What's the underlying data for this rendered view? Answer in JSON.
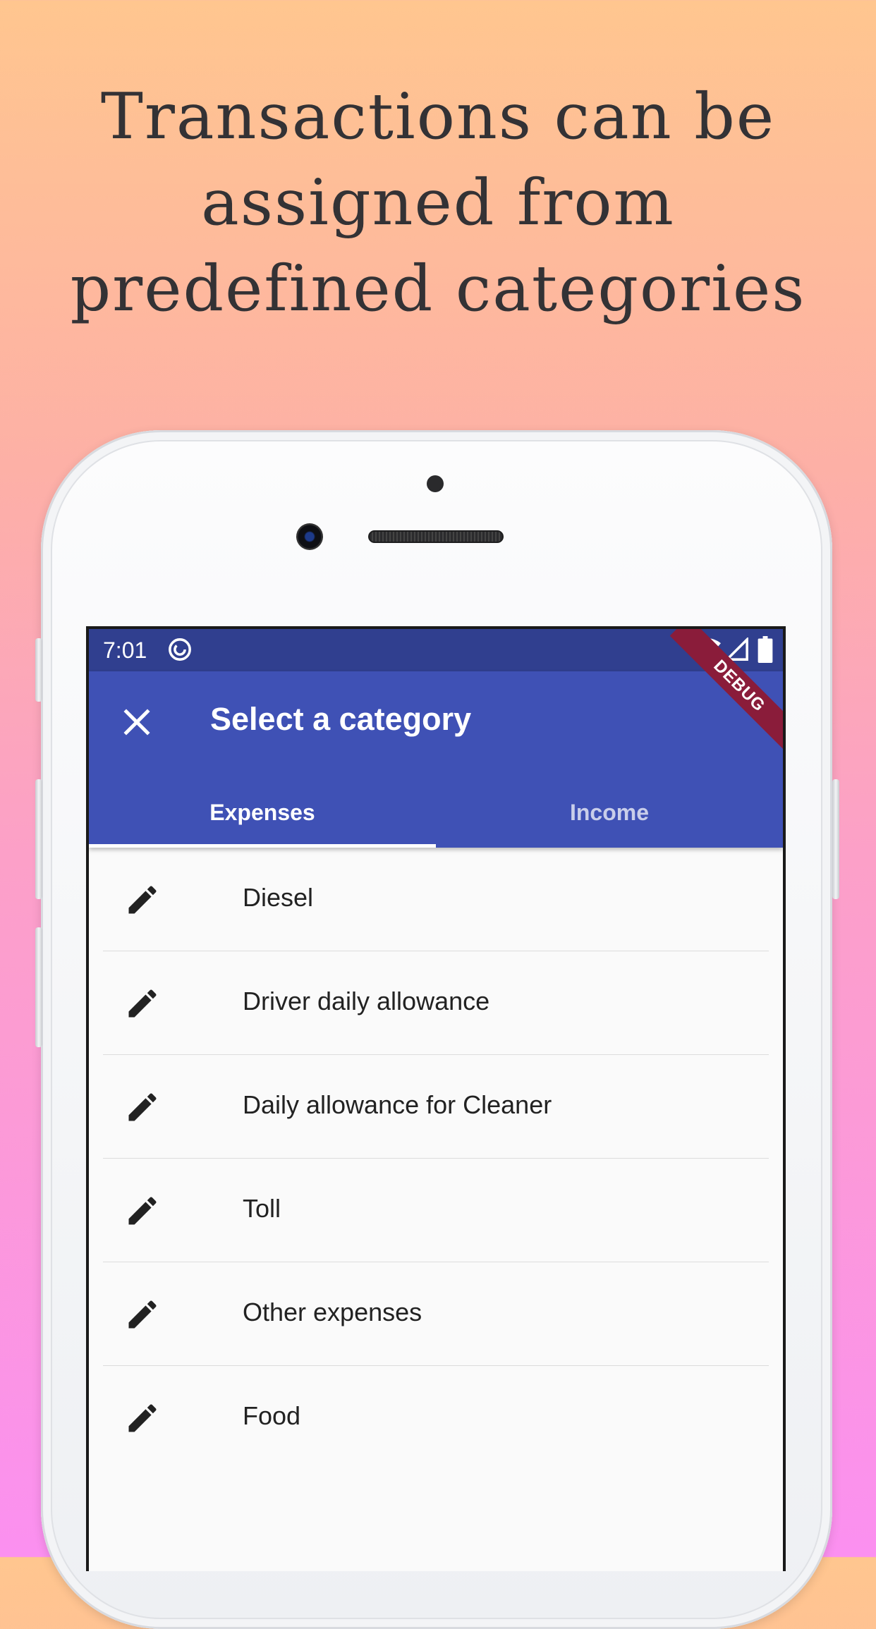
{
  "headline": {
    "line1": "Transactions can be",
    "line2": "assigned from",
    "line3": "predefined categories"
  },
  "statusbar": {
    "time": "7:01",
    "icons": [
      "sync-icon",
      "wifi-icon",
      "signal-icon",
      "battery-icon"
    ]
  },
  "appbar": {
    "close_icon": "close-icon",
    "title": "Select a category",
    "debug_label": "DEBUG"
  },
  "tabs": [
    {
      "label": "Expenses",
      "selected": true
    },
    {
      "label": "Income",
      "selected": false
    }
  ],
  "categories": [
    {
      "icon": "edit-icon",
      "label": "Diesel"
    },
    {
      "icon": "edit-icon",
      "label": "Driver daily allowance"
    },
    {
      "icon": "edit-icon",
      "label": "Daily allowance for Cleaner"
    },
    {
      "icon": "edit-icon",
      "label": "Toll"
    },
    {
      "icon": "edit-icon",
      "label": "Other expenses"
    },
    {
      "icon": "edit-icon",
      "label": "Food"
    }
  ],
  "colors": {
    "statusbar": "#303f8f",
    "appbar": "#3f51b5",
    "debug_banner": "#8a1c3a",
    "headline_text": "#333235"
  }
}
